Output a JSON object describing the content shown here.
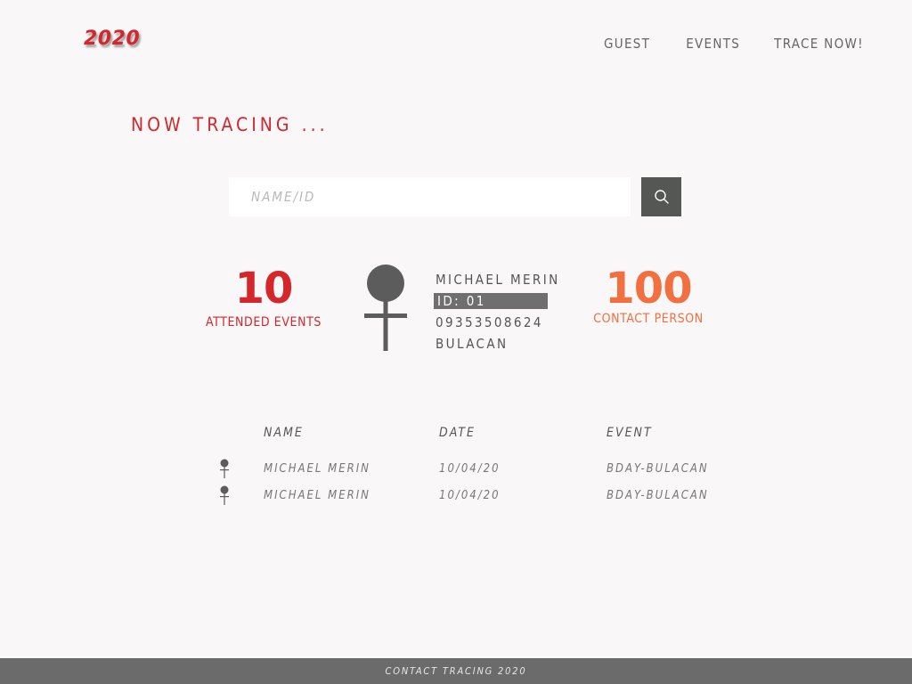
{
  "header": {
    "logo_text": "2020",
    "nav": {
      "guest": "GUEST",
      "events": "EVENTS",
      "trace_now": "TRACE NOW!"
    }
  },
  "main": {
    "heading": "NOW TRACING ...",
    "search": {
      "placeholder": "NAME/ID",
      "value": "",
      "button_icon": "search-icon"
    },
    "attended": {
      "value": "10",
      "label": "ATTENDED EVENTS"
    },
    "profile": {
      "icon": "female-symbol-icon",
      "name": "MICHAEL MERIN",
      "id": "ID: 01",
      "phone": "09353508624",
      "address": "BULACAN"
    },
    "contacts": {
      "value": "100",
      "label": "CONTACT PERSON"
    },
    "history": {
      "columns": [
        "NAME",
        "DATE",
        "EVENT"
      ],
      "rows": [
        {
          "icon": "female-symbol-icon",
          "name": "MICHAEL MERIN",
          "date": "10/04/20",
          "event": "BDAY-BULACAN"
        },
        {
          "icon": "female-symbol-icon",
          "name": "MICHAEL MERIN",
          "date": "10/04/20",
          "event": "BDAY-BULACAN"
        }
      ]
    }
  },
  "footer": {
    "text": "CONTACT TRACING 2020"
  },
  "colors": {
    "background": "#f9f7f7",
    "accent_red": "#d5262b",
    "accent_orange": "#f26f3f",
    "dark_gray": "#555755",
    "footer_gray": "#6b6b6b"
  }
}
